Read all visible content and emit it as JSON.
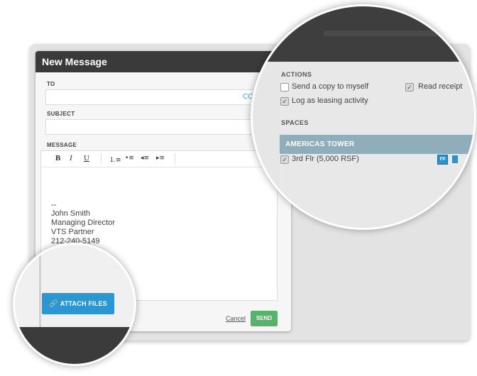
{
  "dialog": {
    "title": "New Message",
    "to_label": "TO",
    "to_value": "",
    "cc_link": "CC",
    "subject_label": "SUBJECT",
    "subject_value": "",
    "message_label": "MESSAGE",
    "toolbar": {
      "bold": "B",
      "italic": "I",
      "underline": "U",
      "ordered_list_icon": "ordered-list",
      "bullet_list_icon": "bullet-list",
      "outdent_icon": "outdent",
      "indent_icon": "indent"
    },
    "signature": [
      "--",
      "John Smith",
      "Managing Director",
      "VTS Partner",
      "212-240-5149"
    ],
    "cancel_label": "Cancel",
    "send_label": "SEND",
    "attach_label": "ATTACH FILES"
  },
  "magnified": {
    "actions_title": "ACTIONS",
    "actions": [
      {
        "label": "Send a copy to myself",
        "checked": false
      },
      {
        "label": "Read receipt",
        "checked": true
      },
      {
        "label": "Log as leasing activity",
        "checked": true
      }
    ],
    "spaces_title": "SPACES",
    "building": "AMERICAS TOWER",
    "space": {
      "label": "3rd Flr (5,000 RSF)",
      "checked": true,
      "fp_badge": "FP"
    }
  },
  "colors": {
    "title_bar": "#3a3a3a",
    "attach_button": "#2a97d2",
    "send_button": "#57b26b",
    "building_bar": "#8fadba",
    "link": "#4aa3d2"
  }
}
